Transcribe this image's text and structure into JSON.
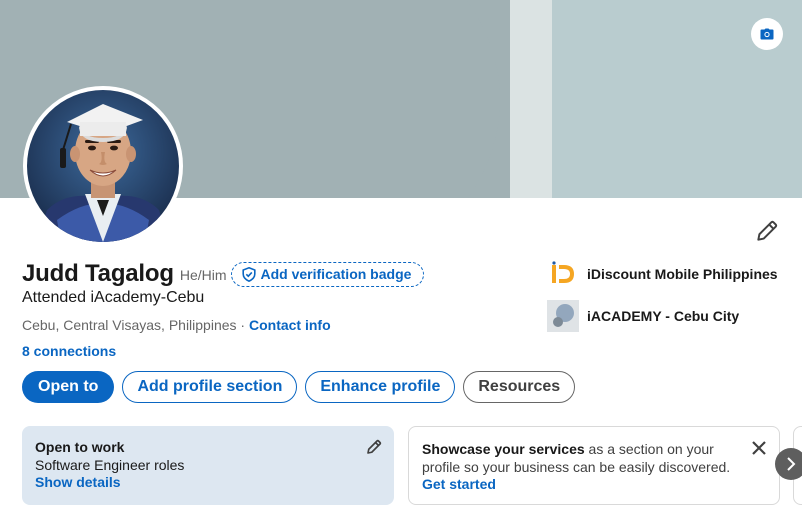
{
  "profile": {
    "name": "Judd Tagalog",
    "pronouns": "He/Him",
    "verification_badge_label": "Add verification badge",
    "headline": "Attended iAcademy-Cebu",
    "location": "Cebu, Central Visayas, Philippines",
    "separator": " · ",
    "contact_info_label": "Contact info",
    "connections": "8 connections"
  },
  "actions": {
    "open_to": "Open to",
    "add_profile_section": "Add profile section",
    "enhance_profile": "Enhance profile",
    "resources": "Resources"
  },
  "organizations": [
    {
      "name": "iDiscount Mobile Philippines",
      "logo": "idiscount-logo",
      "color": "#f5a623"
    },
    {
      "name": "iACADEMY - Cebu City",
      "logo": "iacademy-logo"
    }
  ],
  "open_to_work": {
    "title": "Open to work",
    "roles": "Software Engineer roles",
    "link": "Show details"
  },
  "services_card": {
    "bold": "Showcase your services",
    "rest": " as a section on your profile so your business can be easily discovered.",
    "link": "Get started"
  },
  "icons": {
    "banner_camera": "camera-icon",
    "edit_intro": "pencil-icon",
    "verify": "shield-check-icon",
    "close": "close-icon",
    "next": "chevron-right-icon"
  },
  "colors": {
    "accent": "#0a66c2",
    "banner": "#a1b1b4",
    "open_to_work_bg": "#dde7f1"
  }
}
